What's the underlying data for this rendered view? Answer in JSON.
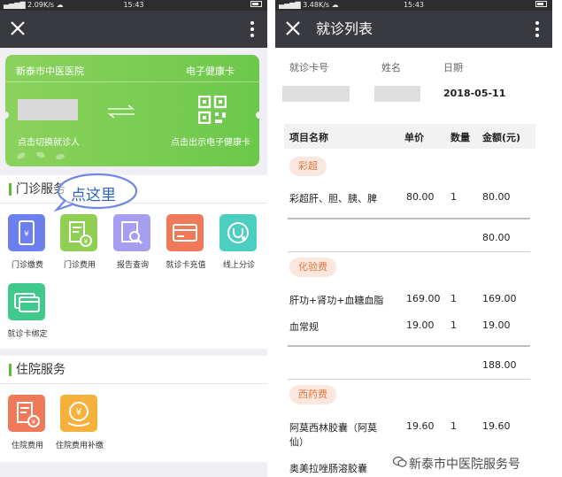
{
  "left": {
    "status": {
      "signal": "▄▅▆▇ 2.09K/s ☁",
      "time": "15:43",
      "battery_icon": "battery-icon"
    },
    "titlebar": {
      "close_icon": "close-icon",
      "more_icon": "more-vertical-icon"
    },
    "card": {
      "hospital": "新泰市中医医院",
      "type": "电子健康卡",
      "hint_switch": "点击切换就诊人",
      "hint_show": "点击出示电子健康卡",
      "swap_icon": "swap-arrows-icon",
      "qr_icon": "qr-code-icon",
      "bg_color": "#6cc84a"
    },
    "clinic": {
      "title": "门诊服务",
      "items": [
        {
          "label": "门诊缴费",
          "icon": "phone-pay-icon",
          "color": "#6c7ff1"
        },
        {
          "label": "门诊费用",
          "icon": "fee-doc-icon",
          "color": "#8fd052"
        },
        {
          "label": "报告查询",
          "icon": "report-search-icon",
          "color": "#a69ef0"
        },
        {
          "label": "就诊卡充值",
          "icon": "card-recharge-icon",
          "color": "#f0795a"
        },
        {
          "label": "线上分诊",
          "icon": "stethoscope-icon",
          "color": "#4ccfc0"
        },
        {
          "label": "就诊卡绑定",
          "icon": "card-bind-icon",
          "color": "#3fc98a"
        }
      ]
    },
    "annotation": {
      "text": "点这里"
    },
    "inpatient": {
      "title": "住院服务",
      "items": [
        {
          "label": "住院费用",
          "icon": "fee-doc-icon",
          "color": "#f0795a"
        },
        {
          "label": "住院费用补缴",
          "icon": "yen-coin-icon",
          "color": "#f5b13c"
        }
      ]
    }
  },
  "right": {
    "status": {
      "signal": "▄▅▆▇ 3.48K/s ☁",
      "time": "15:43"
    },
    "titlebar": {
      "title": "就诊列表"
    },
    "header": {
      "card_no_label": "就诊卡号",
      "name_label": "姓名",
      "date_label": "日期",
      "date_value": "2018-05-11"
    },
    "columns": [
      "项目名称",
      "单价",
      "数量",
      "金额(元)"
    ],
    "groups": [
      {
        "tag": "彩超",
        "rows": [
          {
            "name": "彩超肝、胆、胰、脾",
            "price": "80.00",
            "qty": "1",
            "amount": "80.00"
          }
        ],
        "subtotal": "80.00"
      },
      {
        "tag": "化验费",
        "rows": [
          {
            "name": "肝功+肾功+血糖血脂",
            "price": "169.00",
            "qty": "1",
            "amount": "169.00"
          },
          {
            "name": "血常规",
            "price": "19.00",
            "qty": "1",
            "amount": "19.00"
          }
        ],
        "subtotal": "188.00"
      },
      {
        "tag": "西药费",
        "rows": [
          {
            "name_line1": "阿莫西林胶囊（阿莫",
            "name_line2": "仙）",
            "price": "19.60",
            "qty": "1",
            "amount": "19.60"
          },
          {
            "name": "奥美拉唑肠溶胶囊"
          }
        ]
      }
    ]
  },
  "watermark": {
    "text": "新泰市中医院服务号"
  }
}
